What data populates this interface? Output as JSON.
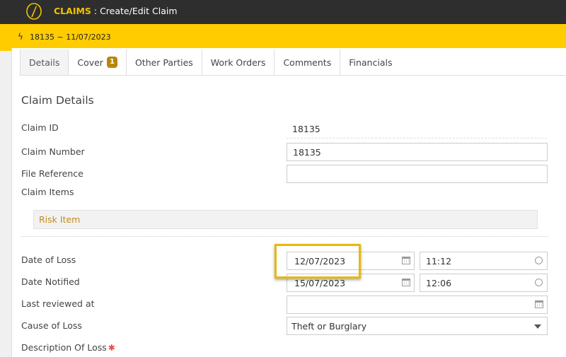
{
  "header": {
    "module": "CLAIMS",
    "separator": " : ",
    "page": "Create/Edit Claim"
  },
  "claim_bar": {
    "reference": "18135 ~ 11/07/2023"
  },
  "tabs": [
    {
      "label": "Details",
      "active": true
    },
    {
      "label": "Cover",
      "badge": "1"
    },
    {
      "label": "Other Parties"
    },
    {
      "label": "Work Orders"
    },
    {
      "label": "Comments"
    },
    {
      "label": "Financials"
    }
  ],
  "section": {
    "title": "Claim Details"
  },
  "fields": {
    "claim_id": {
      "label": "Claim ID",
      "value": "18135"
    },
    "claim_number": {
      "label": "Claim Number",
      "value": "18135"
    },
    "file_reference": {
      "label": "File Reference",
      "value": ""
    },
    "claim_items": {
      "label": "Claim Items",
      "risk_item": "Risk Item"
    },
    "date_of_loss": {
      "label": "Date of Loss",
      "date": "12/07/2023",
      "time": "11:12"
    },
    "date_notified": {
      "label": "Date Notified",
      "date": "15/07/2023",
      "time": "12:06"
    },
    "last_reviewed": {
      "label": "Last reviewed at",
      "value": ""
    },
    "cause_of_loss": {
      "label": "Cause of Loss",
      "value": "Theft or Burglary"
    },
    "description_of_loss": {
      "label": "Description Of Loss",
      "required_mark": "✱"
    }
  },
  "colors": {
    "topbar": "#2e2e2e",
    "accent_yellow": "#ffcc00",
    "badge": "#b8860b",
    "link": "#c58a1c",
    "required": "#e74c3c"
  }
}
